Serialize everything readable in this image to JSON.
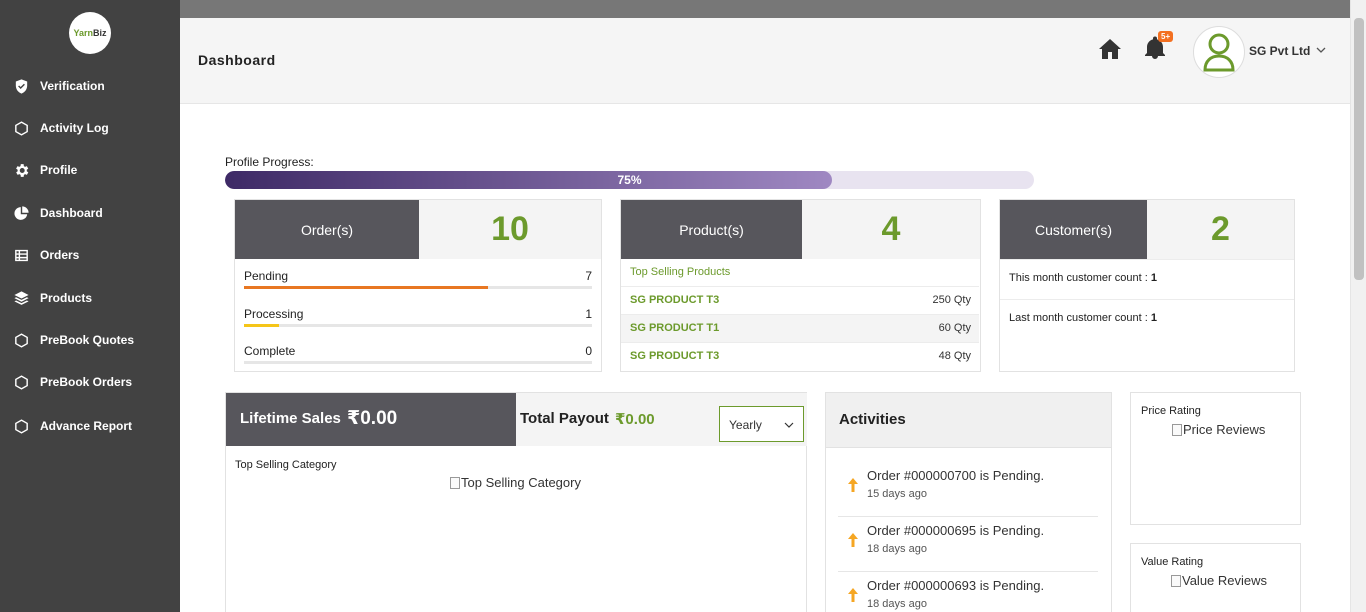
{
  "brand": {
    "logo_text_1": "Yarn",
    "logo_text_2": "Biz"
  },
  "sidebar": {
    "items": [
      {
        "label": "Verification",
        "icon": "shield-check-icon"
      },
      {
        "label": "Activity Log",
        "icon": "hexagon-icon"
      },
      {
        "label": "Profile",
        "icon": "gear-icon"
      },
      {
        "label": "Dashboard",
        "icon": "pie-chart-icon"
      },
      {
        "label": "Orders",
        "icon": "list-icon"
      },
      {
        "label": "Products",
        "icon": "layers-icon"
      },
      {
        "label": "PreBook Quotes",
        "icon": "hexagon-icon"
      },
      {
        "label": "PreBook Orders",
        "icon": "hexagon-icon"
      },
      {
        "label": "Advance Report",
        "icon": "hexagon-icon"
      }
    ]
  },
  "header": {
    "title": "Dashboard",
    "notification_badge": "5+",
    "company": "SG Pvt Ltd"
  },
  "profile_progress": {
    "label": "Profile Progress:",
    "value": 0.75,
    "text": "75%"
  },
  "orders": {
    "label": "Order(s)",
    "count": "10",
    "statuses": [
      {
        "label": "Pending",
        "count": "7",
        "fraction": 0.7,
        "color": "#e87722"
      },
      {
        "label": "Processing",
        "count": "1",
        "fraction": 0.1,
        "color": "#f5c518"
      },
      {
        "label": "Complete",
        "count": "0",
        "fraction": 0,
        "color": "#6c9a2c"
      }
    ]
  },
  "products": {
    "label": "Product(s)",
    "count": "4",
    "top_title": "Top Selling Products",
    "rows": [
      {
        "name": "SG PRODUCT T3",
        "qty": "250 Qty"
      },
      {
        "name": "SG PRODUCT T1",
        "qty": "60 Qty"
      },
      {
        "name": "SG PRODUCT T3",
        "qty": "48 Qty"
      }
    ]
  },
  "customers": {
    "label": "Customer(s)",
    "count": "2",
    "this_month_label": "This month customer count : ",
    "this_month_value": "1",
    "last_month_label": "Last month customer count : ",
    "last_month_value": "1"
  },
  "sales": {
    "lifetime_label": "Lifetime Sales",
    "lifetime_value": "₹0.00",
    "payout_label": "Total Payout",
    "payout_value": "₹0.00",
    "period": "Yearly",
    "category_title": "Top Selling Category",
    "category_alt": "Top Selling Category"
  },
  "activities": {
    "title": "Activities",
    "items": [
      {
        "message": "Order #000000700 is Pending.",
        "time": "15 days ago"
      },
      {
        "message": "Order #000000695 is Pending.",
        "time": "18 days ago"
      },
      {
        "message": "Order #000000693 is Pending.",
        "time": "18 days ago"
      }
    ]
  },
  "ratings": {
    "price_title": "Price Rating",
    "price_alt": "Price Reviews",
    "value_title": "Value Rating",
    "value_alt": "Value Reviews"
  },
  "colors": {
    "accent_green": "#6c9a2c",
    "sidebar_bg": "#424242",
    "card_dark": "#57565c",
    "badge_orange": "#f37021"
  }
}
